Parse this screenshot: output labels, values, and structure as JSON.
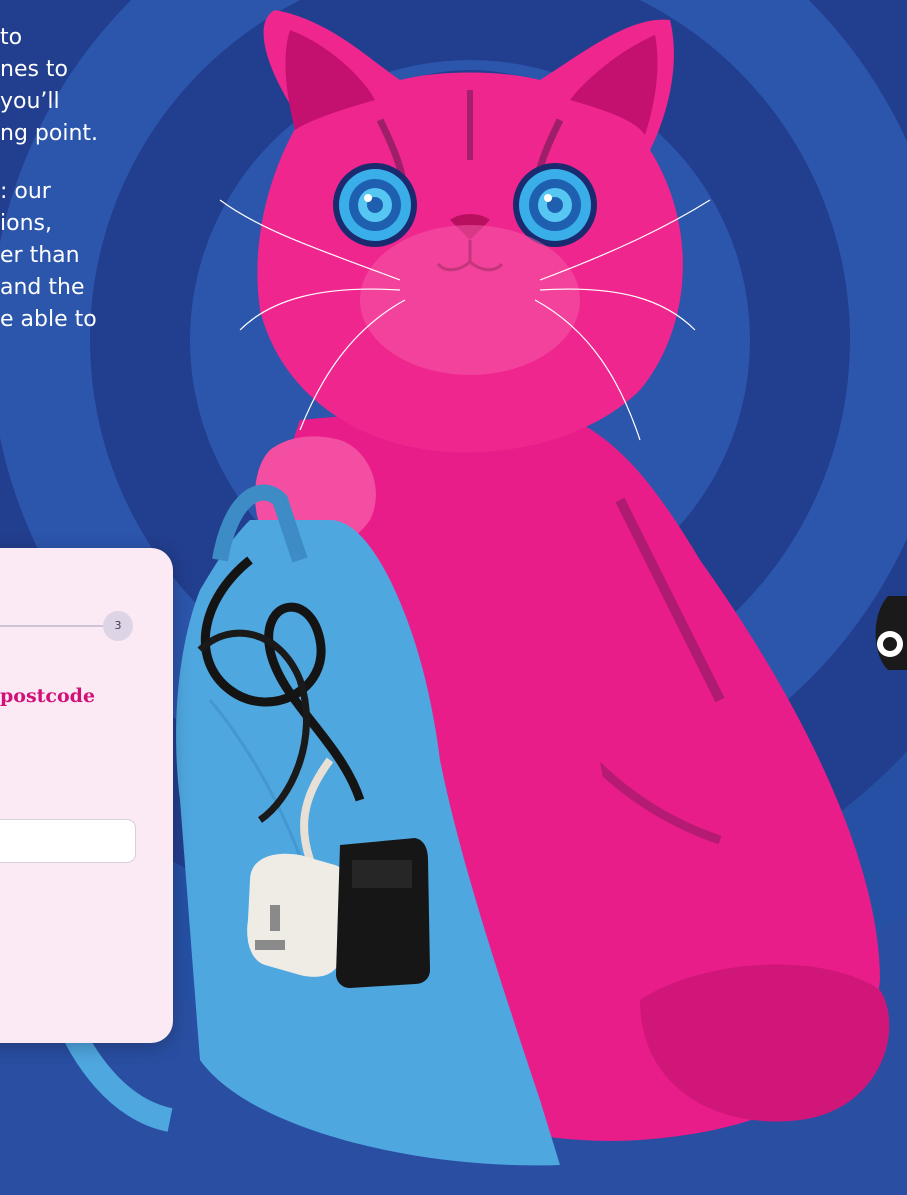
{
  "intro": {
    "paragraph1": [
      "to",
      "nes to",
      "you’ll",
      "ng point."
    ],
    "paragraph2": [
      ": our",
      "ions,",
      "er than",
      "and the",
      "e able to"
    ]
  },
  "form": {
    "step_number": "3",
    "heading": "postcode",
    "postcode_value": "",
    "postcode_placeholder": ""
  },
  "colors": {
    "background": "#2a4fa2",
    "ring_dark": "#223e8e",
    "ring_mid": "#2c55ac",
    "cat_pink": "#ee1f8d",
    "bag_blue": "#4fa7e0",
    "heading_pink": "#d11178",
    "card_bg": "#fbe9f4"
  },
  "illustration": {
    "subject": "pink-cat-with-spiral-eyes-holding-blue-tote-bag-with-cables-and-plug"
  }
}
